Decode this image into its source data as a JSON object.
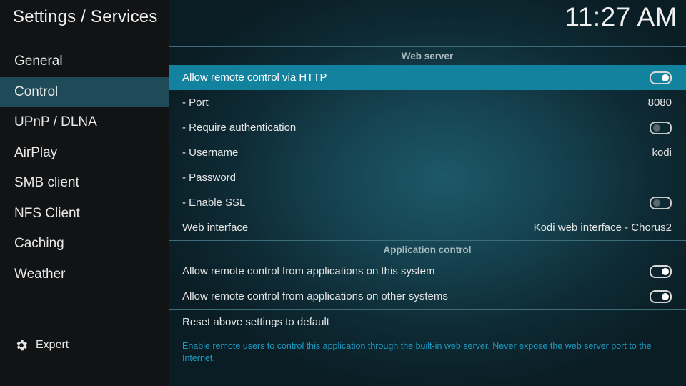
{
  "header": {
    "title": "Settings / Services",
    "clock": "11:27 AM"
  },
  "sidebar": {
    "items": [
      {
        "label": "General",
        "active": false
      },
      {
        "label": "Control",
        "active": true
      },
      {
        "label": "UPnP / DLNA",
        "active": false
      },
      {
        "label": "AirPlay",
        "active": false
      },
      {
        "label": "SMB client",
        "active": false
      },
      {
        "label": "NFS Client",
        "active": false
      },
      {
        "label": "Caching",
        "active": false
      },
      {
        "label": "Weather",
        "active": false
      }
    ],
    "expert_label": "Expert",
    "expert_icon": "gear-icon"
  },
  "sections": {
    "web_server": {
      "title": "Web server",
      "allow_http_label": "Allow remote control via HTTP",
      "allow_http_on": true,
      "port_label": "- Port",
      "port_value": "8080",
      "require_auth_label": "- Require authentication",
      "require_auth_on": false,
      "username_label": "- Username",
      "username_value": "kodi",
      "password_label": "- Password",
      "ssl_label": "- Enable SSL",
      "ssl_on": false,
      "web_interface_label": "Web interface",
      "web_interface_value": "Kodi web interface - Chorus2"
    },
    "application_control": {
      "title": "Application control",
      "this_system_label": "Allow remote control from applications on this system",
      "this_system_on": true,
      "other_systems_label": "Allow remote control from applications on other systems",
      "other_systems_on": true
    },
    "reset_label": "Reset above settings to default"
  },
  "description": "Enable remote users to control this application through the built-in web server. Never expose the web server port to the Internet.",
  "colors": {
    "focus": "#12829f",
    "sidebar_active": "#1f4a57",
    "description_text": "#1f9bc2"
  }
}
